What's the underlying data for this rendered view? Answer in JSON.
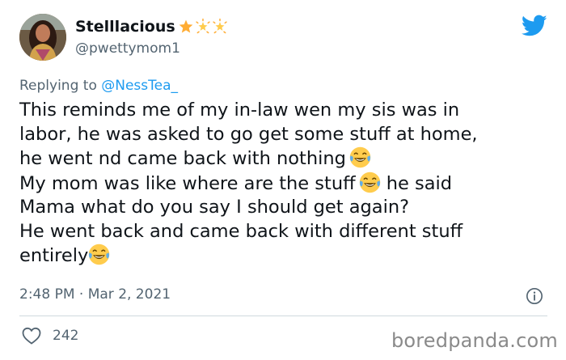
{
  "author": {
    "display_name": "Stelllacious",
    "handle": "@pwettymom1",
    "avatar_icon": "profile-photo",
    "badges": [
      "star-emoji",
      "glowing-star-emoji",
      "glowing-star-emoji"
    ]
  },
  "reply": {
    "prefix": "Replying to ",
    "to": "@NessTea_"
  },
  "tweet": {
    "lines": [
      "This reminds me of my in-law wen my sis was in",
      "labor, he was asked to go get some stuff at home,",
      "he went nd came back with nothing",
      "My mom was like where are the stuff",
      " he said",
      "Mama what do you say I should get again?",
      "He went back and came back with different stuff",
      "entirely"
    ],
    "emoji": "face-with-tears-of-joy"
  },
  "meta": {
    "timestamp": "2:48 PM · Mar 2, 2021"
  },
  "engagement": {
    "likes": "242"
  },
  "watermark": "boredpanda.com",
  "colors": {
    "link": "#1d9bf0",
    "secondary_text": "#536471",
    "divider": "#cfd9de"
  }
}
